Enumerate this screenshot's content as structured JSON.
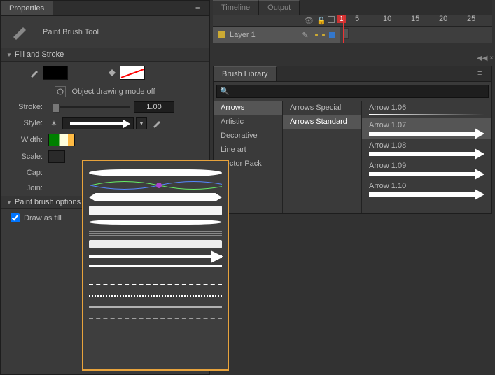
{
  "properties": {
    "tab": "Properties",
    "tool": "Paint Brush Tool",
    "sections": {
      "fillstroke": "Fill and Stroke",
      "paintbrush": "Paint brush options"
    },
    "obj_draw": "Object drawing mode off",
    "labels": {
      "stroke": "Stroke:",
      "style": "Style:",
      "width": "Width:",
      "scale": "Scale:",
      "cap": "Cap:",
      "join": "Join:"
    },
    "stroke_val": "1.00",
    "draw_as_fill": "Draw as fill"
  },
  "timeline": {
    "tab1": "Timeline",
    "tab2": "Output",
    "layer": "Layer 1",
    "ticks": [
      "1",
      "5",
      "10",
      "15",
      "20",
      "25"
    ]
  },
  "brushlib": {
    "tab": "Brush Library",
    "search_placeholder": " ",
    "cats": [
      "Arrows",
      "Artistic",
      "Decorative",
      "Line art",
      "Vector Pack"
    ],
    "sel_cat": 0,
    "subcats": [
      "Arrows Special",
      "Arrows Standard"
    ],
    "sel_sub": 1,
    "brushes": [
      "Arrow 1.06",
      "Arrow 1.07",
      "Arrow 1.08",
      "Arrow 1.09",
      "Arrow 1.10"
    ],
    "sel_brush": 1
  }
}
